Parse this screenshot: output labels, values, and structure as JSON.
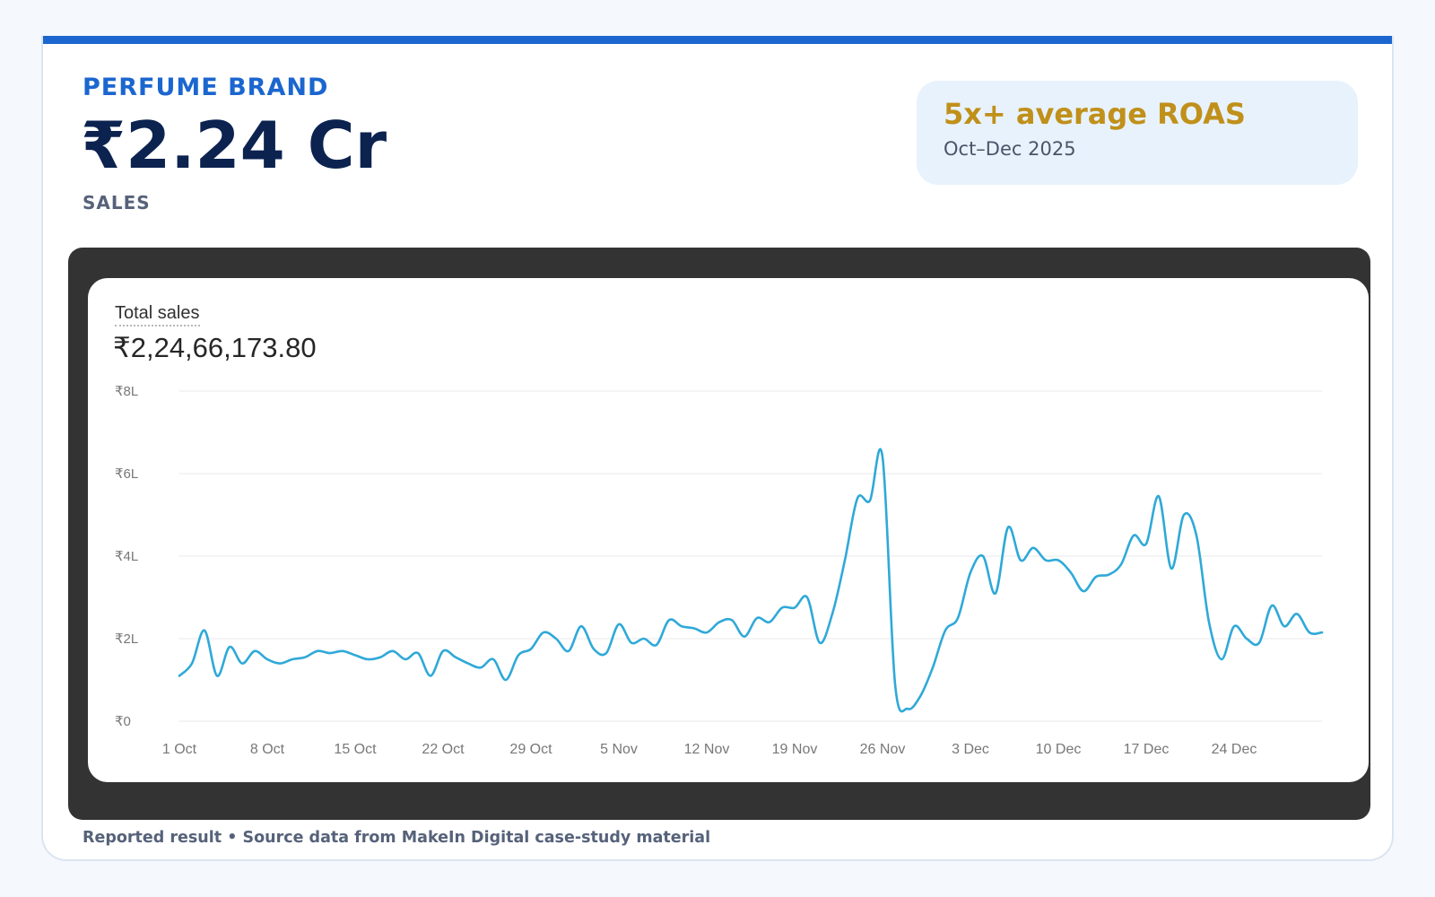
{
  "header": {
    "brand": "PERFUME BRAND",
    "headline": "₹2.24 Cr",
    "metric_label": "SALES"
  },
  "highlight": {
    "title": "5x+ average ROAS",
    "period": "Oct–Dec 2025"
  },
  "footnote": "Reported result • Source data from MakeIn Digital case-study material",
  "colors": {
    "accent": "#1b66cf",
    "headline": "#0c2350",
    "gold": "#c0901a",
    "line": "#2fa9d8"
  },
  "chart_data": {
    "type": "line",
    "title": "Total sales",
    "total": "₹2,24,66,173.80",
    "xlabel": "",
    "ylabel": "",
    "ylim": [
      0,
      800000
    ],
    "grid": true,
    "legend": "none",
    "y_ticks": [
      {
        "value": 0,
        "label": "₹0"
      },
      {
        "value": 200000,
        "label": "₹2L"
      },
      {
        "value": 400000,
        "label": "₹4L"
      },
      {
        "value": 600000,
        "label": "₹6L"
      },
      {
        "value": 800000,
        "label": "₹8L"
      }
    ],
    "x_ticks": [
      {
        "date": "2025-10-01",
        "label": "1 Oct"
      },
      {
        "date": "2025-10-08",
        "label": "8 Oct"
      },
      {
        "date": "2025-10-15",
        "label": "15 Oct"
      },
      {
        "date": "2025-10-22",
        "label": "22 Oct"
      },
      {
        "date": "2025-10-29",
        "label": "29 Oct"
      },
      {
        "date": "2025-11-05",
        "label": "5 Nov"
      },
      {
        "date": "2025-11-12",
        "label": "12 Nov"
      },
      {
        "date": "2025-11-19",
        "label": "19 Nov"
      },
      {
        "date": "2025-11-26",
        "label": "26 Nov"
      },
      {
        "date": "2025-12-03",
        "label": "3 Dec"
      },
      {
        "date": "2025-12-10",
        "label": "10 Dec"
      },
      {
        "date": "2025-12-17",
        "label": "17 Dec"
      },
      {
        "date": "2025-12-24",
        "label": "24 Dec"
      }
    ],
    "series": [
      {
        "x": [
          "2025-10-01",
          "2025-10-02",
          "2025-10-03",
          "2025-10-04",
          "2025-10-05",
          "2025-10-06",
          "2025-10-07",
          "2025-10-08",
          "2025-10-09",
          "2025-10-10",
          "2025-10-11",
          "2025-10-12",
          "2025-10-13",
          "2025-10-14",
          "2025-10-15",
          "2025-10-16",
          "2025-10-17",
          "2025-10-18",
          "2025-10-19",
          "2025-10-20",
          "2025-10-21",
          "2025-10-22",
          "2025-10-23",
          "2025-10-24",
          "2025-10-25",
          "2025-10-26",
          "2025-10-27",
          "2025-10-28",
          "2025-10-29",
          "2025-10-30",
          "2025-10-31",
          "2025-11-01",
          "2025-11-02",
          "2025-11-03",
          "2025-11-04",
          "2025-11-05",
          "2025-11-06",
          "2025-11-07",
          "2025-11-08",
          "2025-11-09",
          "2025-11-10",
          "2025-11-11",
          "2025-11-12",
          "2025-11-13",
          "2025-11-14",
          "2025-11-15",
          "2025-11-16",
          "2025-11-17",
          "2025-11-18",
          "2025-11-19",
          "2025-11-20",
          "2025-11-21",
          "2025-11-22",
          "2025-11-23",
          "2025-11-24",
          "2025-11-25",
          "2025-11-26",
          "2025-11-27",
          "2025-11-28",
          "2025-11-29",
          "2025-11-30",
          "2025-12-01",
          "2025-12-02",
          "2025-12-03",
          "2025-12-04",
          "2025-12-05",
          "2025-12-06",
          "2025-12-07",
          "2025-12-08",
          "2025-12-09",
          "2025-12-10",
          "2025-12-11",
          "2025-12-12",
          "2025-12-13",
          "2025-12-14",
          "2025-12-15",
          "2025-12-16",
          "2025-12-17",
          "2025-12-18",
          "2025-12-19",
          "2025-12-20",
          "2025-12-21",
          "2025-12-22",
          "2025-12-23",
          "2025-12-24",
          "2025-12-25",
          "2025-12-26",
          "2025-12-27",
          "2025-12-28",
          "2025-12-29",
          "2025-12-30",
          "2025-12-31"
        ],
        "values": [
          110000,
          140000,
          220000,
          110000,
          180000,
          140000,
          170000,
          150000,
          140000,
          150000,
          155000,
          170000,
          165000,
          170000,
          160000,
          150000,
          155000,
          170000,
          150000,
          165000,
          110000,
          170000,
          155000,
          140000,
          130000,
          150000,
          100000,
          160000,
          175000,
          215000,
          200000,
          170000,
          230000,
          175000,
          165000,
          235000,
          190000,
          200000,
          185000,
          245000,
          230000,
          225000,
          215000,
          240000,
          245000,
          205000,
          250000,
          240000,
          275000,
          275000,
          300000,
          190000,
          260000,
          390000,
          540000,
          535000,
          640000,
          90000,
          30000,
          60000,
          130000,
          220000,
          250000,
          360000,
          400000,
          310000,
          470000,
          390000,
          420000,
          390000,
          390000,
          360000,
          315000,
          350000,
          355000,
          380000,
          450000,
          430000,
          545000,
          370000,
          500000,
          450000,
          240000,
          150000,
          230000,
          200000,
          190000,
          280000,
          230000,
          260000,
          215000,
          215000
        ]
      }
    ]
  }
}
